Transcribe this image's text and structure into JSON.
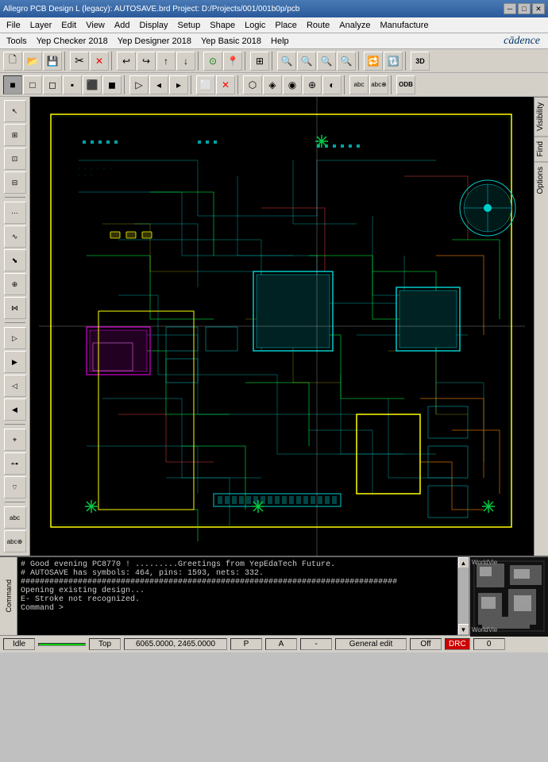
{
  "titlebar": {
    "title": "Allegro PCB Design L (legacy): AUTOSAVE.brd  Project: D:/Projects/001/001b0p/pcb",
    "minimize": "─",
    "maximize": "□",
    "close": "✕"
  },
  "menubar1": {
    "items": [
      "File",
      "Layer",
      "Edit",
      "View",
      "Add",
      "Display",
      "Setup",
      "Shape",
      "Logic",
      "Place",
      "Route",
      "Analyze",
      "Manufacture"
    ]
  },
  "menubar2": {
    "items": [
      "Tools",
      "Yep Checker 2018",
      "Yep Designer 2018",
      "Yep Basic 2018",
      "Help"
    ],
    "logo": "cādence"
  },
  "toolbar1": {
    "buttons": [
      "📁",
      "📂",
      "💾",
      "✂",
      "🗑",
      "↩",
      "↪",
      "⬆",
      "⬇",
      "⬤",
      "📌",
      "▦",
      "🔍",
      "🔍",
      "🔍",
      "🔍",
      "🔁",
      "🔃",
      "3D"
    ]
  },
  "toolbar2": {
    "buttons": [
      "■",
      "□",
      "◻",
      "▪",
      "▫",
      "⬛",
      "◼",
      "◻",
      "▷",
      "▸",
      "◂",
      "▹",
      "⬜",
      "✕",
      "⬡",
      "⬢",
      "◈",
      "◉",
      "⊕",
      "◐",
      "ODB"
    ]
  },
  "rightpanel": {
    "tabs": [
      "Visibility",
      "Find",
      "Options"
    ]
  },
  "console": {
    "label": "Command",
    "lines": [
      "# Good evening PC8770 !      .........Greetings from YepEdaTech Future.",
      "# AUTOSAVE has symbols: 464, pins: 1593, nets: 332.",
      "###############################################################################",
      "Opening existing design...",
      "E- Stroke not recognized.",
      "Command >"
    ]
  },
  "statusbar": {
    "idle": "Idle",
    "status_green": "",
    "layer": "Top",
    "coords": "6065.0000, 2465.0000",
    "p_flag": "P",
    "a_flag": "A",
    "dash": "-",
    "mode": "General edit",
    "off": "Off",
    "drc": "DRC",
    "zero": "0"
  },
  "minimap": {
    "label": "WorldVie"
  }
}
